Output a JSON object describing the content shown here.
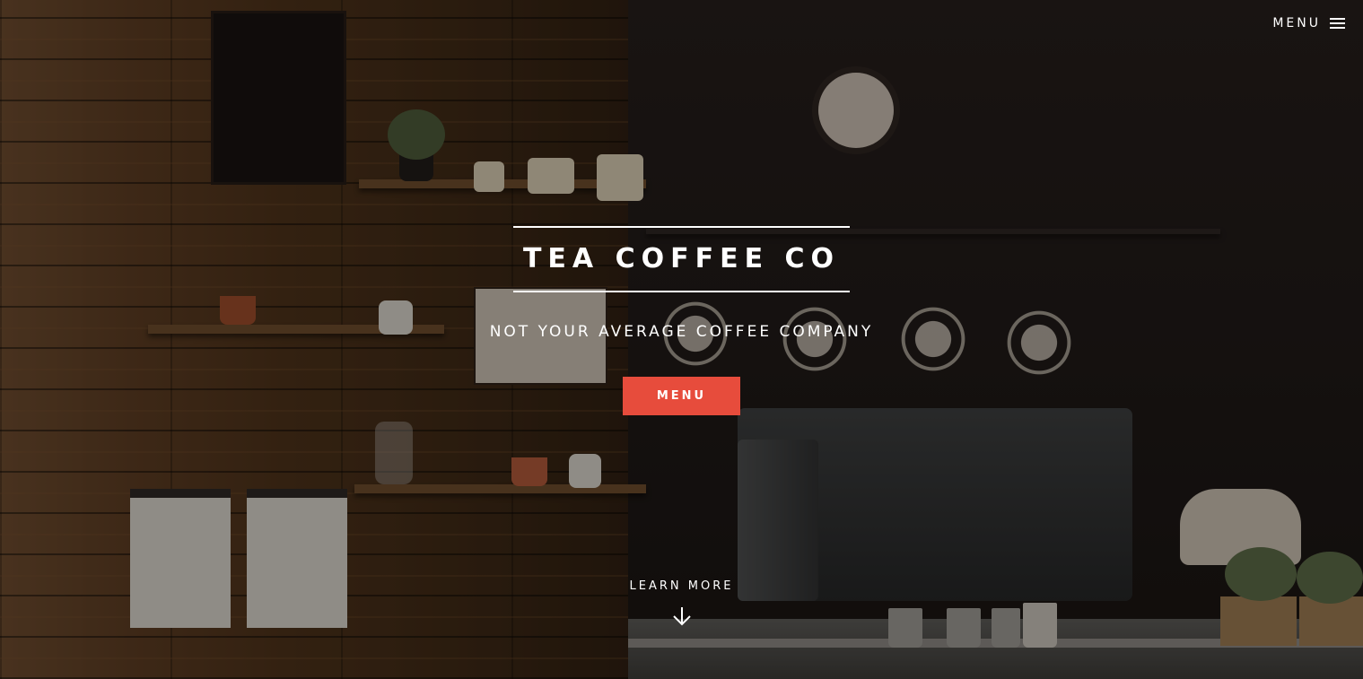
{
  "nav": {
    "menu_label": "MENU",
    "menu_icon": "hamburger-icon"
  },
  "hero": {
    "title": "TEA COFFEE CO",
    "tagline": "NOT YOUR AVERAGE COFFEE COMPANY",
    "cta_label": "MENU",
    "learn_more_label": "LEARN MORE",
    "learn_more_icon": "arrow-down-icon"
  },
  "colors": {
    "accent": "#e74c3c",
    "text": "#ffffff",
    "overlay": "#0a0604"
  }
}
